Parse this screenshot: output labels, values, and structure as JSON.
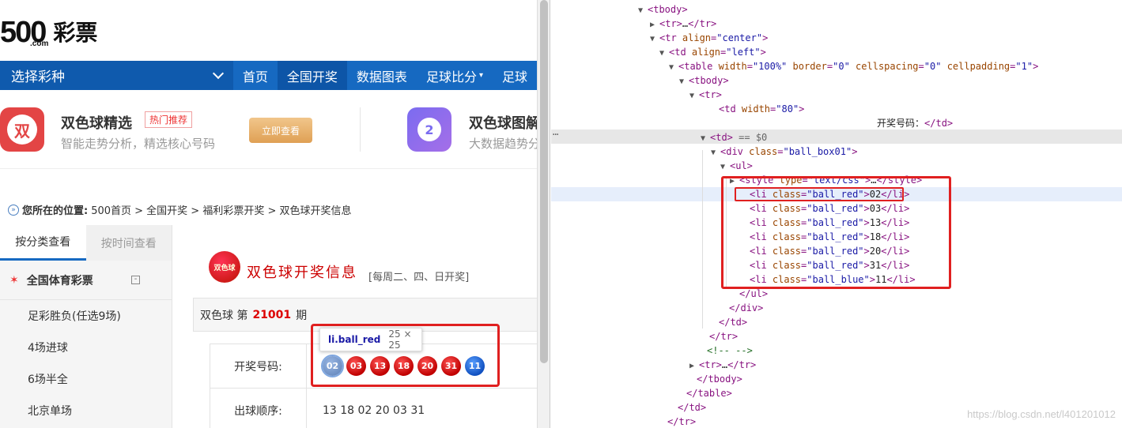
{
  "logo": {
    "number": "500",
    "domain": ".com",
    "name": "彩票"
  },
  "nav": {
    "select_label": "选择彩种",
    "items": [
      "首页",
      "全国开奖",
      "数据图表",
      "足球比分",
      "足球"
    ]
  },
  "promo": {
    "item1": {
      "icon_char": "双",
      "title": "双色球精选",
      "tag": "热门推荐",
      "subtitle": "智能走势分析，精选核心号码",
      "button": "立即查看"
    },
    "item2": {
      "icon_char": "2",
      "title": "双色球图解",
      "subtitle": "大数据趋势分"
    }
  },
  "breadcrumb": {
    "label": "您所在的位置:",
    "path": "500首页 > 全国开奖 > 福利彩票开奖 > 双色球开奖信息"
  },
  "sidebar": {
    "tabs": [
      "按分类查看",
      "按时间查看"
    ],
    "category": "全国体育彩票",
    "collapse_symbol": "-",
    "items": [
      "足彩胜负(任选9场)",
      "4场进球",
      "6场半全",
      "北京单场"
    ]
  },
  "content": {
    "logo_text": "双色球",
    "title": "双色球开奖信息",
    "schedule": "[每周二、四、日开奖]",
    "issue_prefix": "双色球 第",
    "issue_no": "21001",
    "issue_suffix": "期",
    "rows": [
      {
        "label": "开奖号码:"
      },
      {
        "label": "出球顺序:",
        "value": "13 18 02 20 03 31"
      }
    ],
    "balls": [
      {
        "num": "02",
        "color": "red",
        "highlighted": true
      },
      {
        "num": "03",
        "color": "red"
      },
      {
        "num": "13",
        "color": "red"
      },
      {
        "num": "18",
        "color": "red"
      },
      {
        "num": "20",
        "color": "red"
      },
      {
        "num": "31",
        "color": "red"
      },
      {
        "num": "11",
        "color": "blue"
      }
    ],
    "tooltip": {
      "selector": "li.ball_red",
      "size": "25 × 25"
    }
  },
  "devtools": {
    "lines": [
      {
        "tri": "▼",
        "html": "<span class='tg'>&lt;tbody&gt;</span>"
      },
      {
        "tri": "▶",
        "html": "<span class='tg'>&lt;tr&gt;</span><span class='tx'>…</span><span class='tg'>&lt;/tr&gt;</span>"
      },
      {
        "tri": "▼",
        "html": "<span class='tg'>&lt;tr </span><span class='an'>align</span><span class='tg'>=</span><span class='av'>\"center\"</span><span class='tg'>&gt;</span>"
      },
      {
        "tri": "▼",
        "html": "<span class='tg'>&lt;td </span><span class='an'>align</span><span class='tg'>=</span><span class='av'>\"left\"</span><span class='tg'>&gt;</span>"
      },
      {
        "tri": "▼",
        "html": "<span class='tg'>&lt;table </span><span class='an'>width</span><span class='tg'>=</span><span class='av'>\"100%\"</span> <span class='an'>border</span><span class='tg'>=</span><span class='av'>\"0\"</span> <span class='an'>cellspacing</span><span class='tg'>=</span><span class='av'>\"0\"</span> <span class='an'>cellpadding</span><span class='tg'>=</span><span class='av'>\"1\"</span><span class='tg'>&gt;</span>"
      },
      {
        "tri": "▼",
        "html": "<span class='tg'>&lt;tbody&gt;</span>"
      },
      {
        "tri": "▼",
        "html": "<span class='tg'>&lt;tr&gt;</span>"
      },
      {
        "tri": "",
        "html": "<span class='tg'>&lt;td </span><span class='an'>width</span><span class='tg'>=</span><span class='av'>\"80\"</span><span class='tg'>&gt;</span>"
      },
      {
        "tri": "",
        "html": "<span class='tx'>开奖号码：</span><span class='tg'>&lt;/td&gt;</span>"
      },
      {
        "tri": "▼",
        "html": "<span class='tg'>&lt;td&gt;</span> <span class='eq'>== $0</span>"
      },
      {
        "tri": "▼",
        "html": "<span class='tg'>&lt;div </span><span class='an'>class</span><span class='tg'>=</span><span class='av'>\"ball_box01\"</span><span class='tg'>&gt;</span>"
      },
      {
        "tri": "▼",
        "html": "<span class='tg'>&lt;ul&gt;</span>"
      },
      {
        "tri": "▶",
        "html": "<span class='tg'>&lt;style </span><span class='an'>type</span><span class='tg'>=</span><span class='av'>\"text/css\"</span><span class='tg'>&gt;</span><span class='tx'>…</span><span class='tg'>&lt;/style&gt;</span>"
      },
      {
        "tri": "",
        "html": "<span class='tg'>&lt;li </span><span class='an'>class</span><span class='tg'>=</span><span class='av'>\"ball_red\"</span><span class='tg'>&gt;</span><span class='tx'>02</span><span class='tg'>&lt;/li&gt;</span>"
      },
      {
        "tri": "",
        "html": "<span class='tg'>&lt;li </span><span class='an'>class</span><span class='tg'>=</span><span class='av'>\"ball_red\"</span><span class='tg'>&gt;</span><span class='tx'>03</span><span class='tg'>&lt;/li&gt;</span>"
      },
      {
        "tri": "",
        "html": "<span class='tg'>&lt;li </span><span class='an'>class</span><span class='tg'>=</span><span class='av'>\"ball_red\"</span><span class='tg'>&gt;</span><span class='tx'>13</span><span class='tg'>&lt;/li&gt;</span>"
      },
      {
        "tri": "",
        "html": "<span class='tg'>&lt;li </span><span class='an'>class</span><span class='tg'>=</span><span class='av'>\"ball_red\"</span><span class='tg'>&gt;</span><span class='tx'>18</span><span class='tg'>&lt;/li&gt;</span>"
      },
      {
        "tri": "",
        "html": "<span class='tg'>&lt;li </span><span class='an'>class</span><span class='tg'>=</span><span class='av'>\"ball_red\"</span><span class='tg'>&gt;</span><span class='tx'>20</span><span class='tg'>&lt;/li&gt;</span>"
      },
      {
        "tri": "",
        "html": "<span class='tg'>&lt;li </span><span class='an'>class</span><span class='tg'>=</span><span class='av'>\"ball_red\"</span><span class='tg'>&gt;</span><span class='tx'>31</span><span class='tg'>&lt;/li&gt;</span>"
      },
      {
        "tri": "",
        "html": "<span class='tg'>&lt;li </span><span class='an'>class</span><span class='tg'>=</span><span class='av'>\"ball_blue\"</span><span class='tg'>&gt;</span><span class='tx'>11</span><span class='tg'>&lt;/li&gt;</span>"
      },
      {
        "tri": "",
        "html": "<span class='tg'>&lt;/ul&gt;</span>"
      },
      {
        "tri": "",
        "html": "<span class='tg'>&lt;/div&gt;</span>"
      },
      {
        "tri": "",
        "html": "<span class='tg'>&lt;/td&gt;</span>"
      },
      {
        "tri": "",
        "html": "<span class='tg'>&lt;/tr&gt;</span>"
      },
      {
        "tri": "",
        "html": "<span class='cm'>&lt;!-- --&gt;</span>"
      },
      {
        "tri": "▶",
        "html": "<span class='tg'>&lt;tr&gt;</span><span class='tx'>…</span><span class='tg'>&lt;/tr&gt;</span>"
      },
      {
        "tri": "",
        "html": "<span class='tg'>&lt;/tbody&gt;</span>"
      },
      {
        "tri": "",
        "html": "<span class='tg'>&lt;/table&gt;</span>"
      },
      {
        "tri": "",
        "html": "<span class='tg'>&lt;/td&gt;</span>"
      },
      {
        "tri": "",
        "html": "<span class='tg'>&lt;/tr&gt;</span>"
      }
    ],
    "watermark": "https://blog.csdn.net/l401201012"
  }
}
